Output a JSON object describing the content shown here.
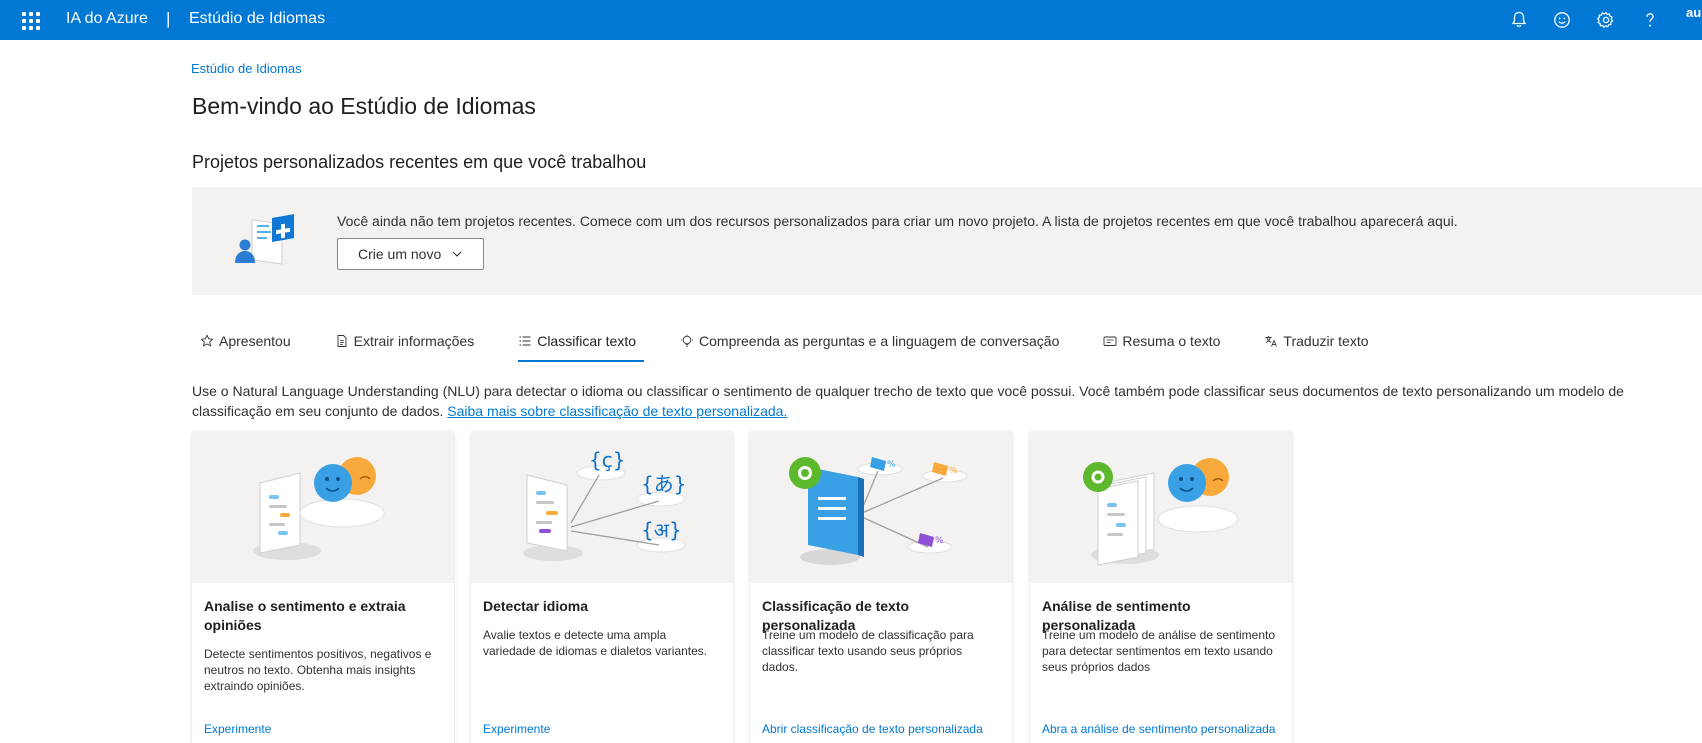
{
  "topbar": {
    "brand": "IA do Azure",
    "separator": "|",
    "product": "Estúdio de Idiomas",
    "avatar": "au"
  },
  "breadcrumb": "Estúdio de Idiomas",
  "page_title": "Bem-vindo ao Estúdio de Idiomas",
  "recent": {
    "title": "Projetos personalizados recentes em que você trabalhou",
    "empty_message": "Você ainda não tem projetos recentes. Comece com um dos recursos personalizados para criar um novo projeto. A lista de projetos recentes em que você trabalhou aparecerá aqui.",
    "create_button": "Crie um novo"
  },
  "tabs": [
    {
      "label": "Apresentou",
      "icon": "star-icon"
    },
    {
      "label": "Extrair informações",
      "icon": "document-icon"
    },
    {
      "label": "Classificar texto",
      "icon": "list-icon",
      "active": true
    },
    {
      "label": "Compreenda as perguntas e a linguagem de conversação",
      "icon": "chat-bulb-icon"
    },
    {
      "label": "Resuma o texto",
      "icon": "summary-icon"
    },
    {
      "label": "Traduzir texto",
      "icon": "translate-icon"
    }
  ],
  "description": {
    "text": "Use o Natural Language Understanding (NLU) para detectar o idioma ou classificar o sentimento de qualquer trecho de texto que você possui. Você também pode classificar seus documentos de texto personalizando um modelo de classificação em seu conjunto de dados.",
    "link": "Saiba mais sobre classificação de texto personalizada."
  },
  "cards": [
    {
      "title": "Analise o sentimento e extraia opiniões",
      "description": "Detecte sentimentos positivos, negativos e neutros no texto. Obtenha mais insights extraindo opiniões.",
      "link": "Experimente"
    },
    {
      "title": "Detectar idioma",
      "description": "Avalie textos e detecte uma ampla variedade de idiomas e dialetos variantes.",
      "link": "Experimente"
    },
    {
      "title": "Classificação de texto personalizada",
      "description": "Treine um modelo de classificação para classificar texto usando seus próprios dados.",
      "link": "Abrir classificação de texto personalizada"
    },
    {
      "title": "Análise de sentimento personalizada",
      "description": "Treine um modelo de análise de sentimento para detectar sentimentos em texto usando seus próprios dados",
      "link": "Abra a análise de sentimento personalizada"
    }
  ],
  "colors": {
    "brand": "#0078d4",
    "banner_bg": "#f3f2f1",
    "text": "#323130"
  }
}
